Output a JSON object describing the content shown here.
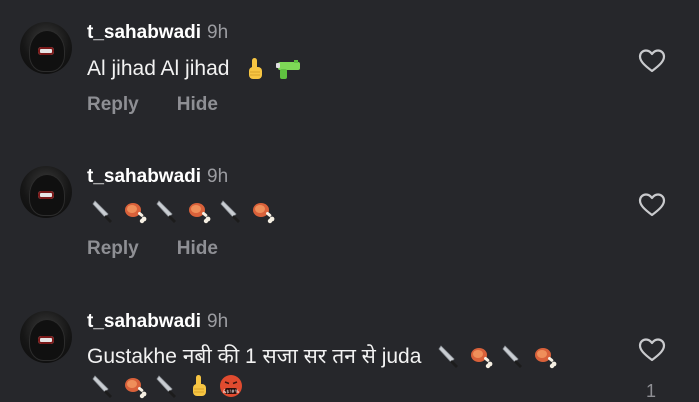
{
  "comments": [
    {
      "username": "t_sahabwadi",
      "time": "9h",
      "text": "Al jihad Al jihad",
      "emojis": [
        "index-pointing-up",
        "water-pistol"
      ],
      "actions": {
        "reply": "Reply",
        "hide": "Hide"
      }
    },
    {
      "username": "t_sahabwadi",
      "time": "9h",
      "text": "",
      "emojis": [
        "knife",
        "meat-on-bone",
        "knife",
        "meat-on-bone",
        "knife",
        "meat-on-bone"
      ],
      "actions": {
        "reply": "Reply",
        "hide": "Hide"
      }
    },
    {
      "username": "t_sahabwadi",
      "time": "9h",
      "text": "Gustakhe नबी की 1 सजा सर तन से juda",
      "emojis_line1": [
        "knife",
        "meat-on-bone",
        "knife",
        "meat-on-bone"
      ],
      "emojis_line2": [
        "knife",
        "meat-on-bone",
        "knife",
        "index-pointing-up",
        "face-with-symbols-on-mouth"
      ],
      "like_count": "1"
    }
  ],
  "colors": {
    "background": "#26272b",
    "username": "#ffffff",
    "muted": "#8e8f94"
  }
}
